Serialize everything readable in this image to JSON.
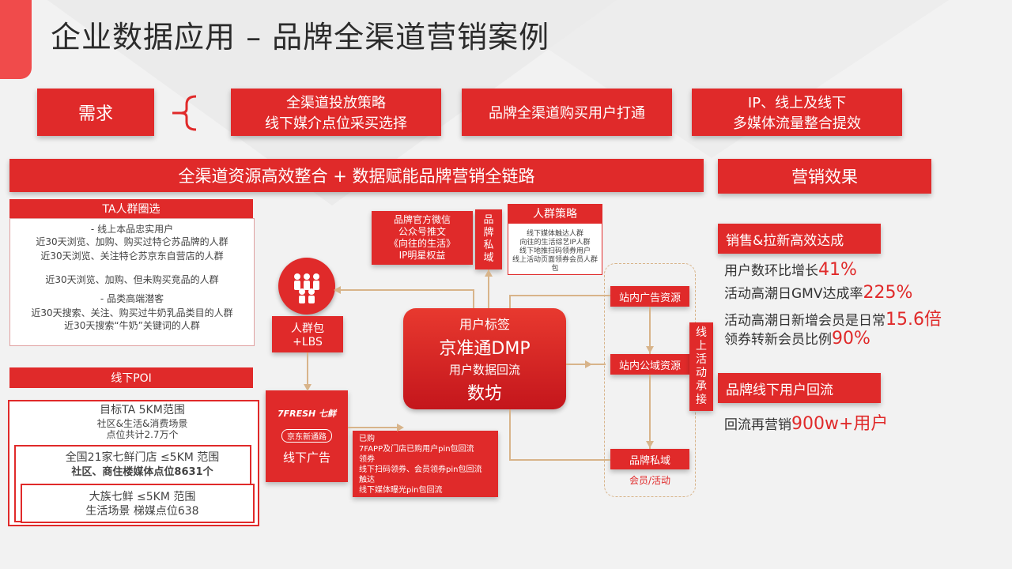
{
  "title": "企业数据应用 – 品牌全渠道营销案例",
  "demand": {
    "label": "需求",
    "items": [
      {
        "line1": "全渠道投放策略",
        "line2": "线下媒介点位采买选择"
      },
      {
        "line1": "品牌全渠道购买用户打通",
        "line2": ""
      },
      {
        "line1": "IP、线上及线下",
        "line2": "多媒体流量整合提效"
      }
    ]
  },
  "banner": "全渠道资源高效整合 + 数据赋能品牌营销全链路",
  "effect_header": "营销效果",
  "ta": {
    "header": "TA人群圈选",
    "lines": [
      "- 线上本品忠实用户",
      "近30天浏览、加购、购买过特仑苏品牌的人群",
      "近30天浏览、关注特仑苏京东自营店的人群",
      "近30天浏览、加购、但未购买竞品的人群",
      "- 品类高端潜客",
      "近30天搜索、关注、购买过牛奶乳品类目的人群",
      "近30天搜索“牛奶”关键词的人群"
    ]
  },
  "poi": {
    "header": "线下POI",
    "lines": [
      "目标TA 5KM范围",
      "社区&生活&消费场景",
      "点位共计2.7万个",
      "全国21家七鲜门店 ≤5KM 范围",
      "社区、商住楼媒体点位8631个",
      "大族七鲜 ≤5KM 范围",
      "生活场景 梯媒点位638"
    ]
  },
  "wechat": {
    "lines": [
      "品牌官方微信",
      "公众号推文",
      "《向往的生活》",
      "IP明星权益"
    ]
  },
  "brand_private_v": [
    "品",
    "牌",
    "私",
    "域"
  ],
  "crowd_strategy": {
    "header": "人群策略",
    "lines": [
      "线下媒体触达人群",
      "向往的生活综艺IP人群",
      "线下地推扫码领券用户",
      "线上活动页面领券会员人群",
      "包"
    ]
  },
  "crowd_pack": {
    "line1": "人群包",
    "line2": "+LBS"
  },
  "dmp": {
    "l1": "用户标签",
    "l2": "京准通DMP",
    "l3": "用户数据回流",
    "l4": "数坊"
  },
  "fresh": {
    "logo": "7FRESH 七鲜",
    "sub": "京东新通路",
    "label": "线下广告"
  },
  "repurchase": {
    "lines": [
      "已购",
      "7FAPP及门店已购用户pin包回流",
      "领券",
      "线下扫码领券、会员领券pin包回流",
      "触达",
      "线下媒体曝光pin包回流"
    ]
  },
  "resources": {
    "ad": "站内广告资源",
    "public": "站内公域资源",
    "private": "品牌私域",
    "member": "会员/活动"
  },
  "online_activity_v": [
    "线",
    "上",
    "活",
    "动",
    "承",
    "接"
  ],
  "sales": {
    "header": "销售&拉新高效达成",
    "metrics": [
      {
        "text": "用户数环比增长",
        "value": "41%"
      },
      {
        "text": "活动高潮日GMV达成率",
        "value": "225%"
      },
      {
        "text": "活动高潮日新增会员是日常",
        "value": "15.6倍"
      },
      {
        "text": "领券转新会员比例",
        "value": "90%"
      }
    ]
  },
  "offline": {
    "header": "品牌线下用户回流",
    "metric": {
      "text": "回流再营销",
      "value": "900w+用户"
    }
  },
  "colors": {
    "brand_red": "#e02a2a",
    "connector": "#d8b48a"
  },
  "icons": [
    "people-group-icon"
  ]
}
